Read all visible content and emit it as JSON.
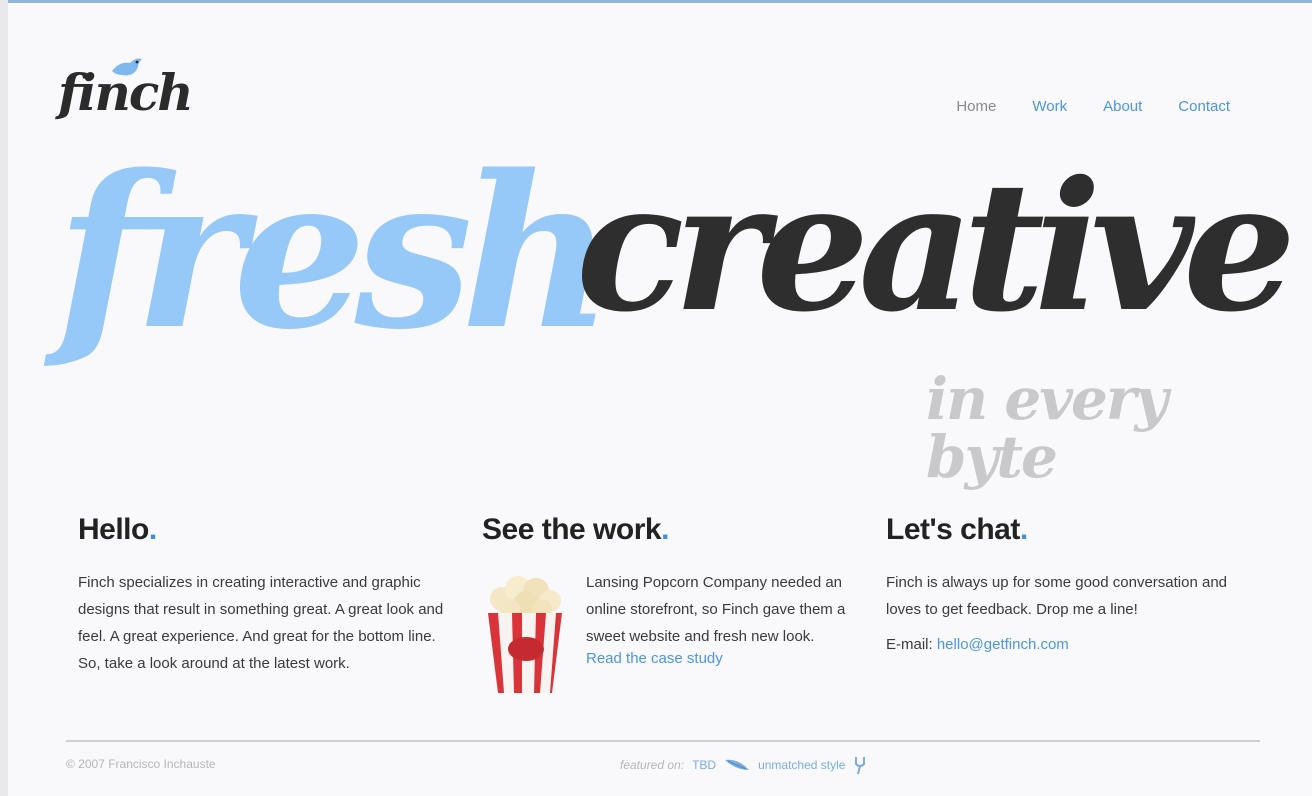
{
  "logo": {
    "text": "finch"
  },
  "nav": {
    "items": [
      {
        "label": "Home",
        "current": true
      },
      {
        "label": "Work",
        "current": false
      },
      {
        "label": "About",
        "current": false
      },
      {
        "label": "Contact",
        "current": false
      }
    ]
  },
  "hero": {
    "word1": "fresh",
    "word2": "creative",
    "subline": "in every byte"
  },
  "hello": {
    "heading": "Hello",
    "body": "Finch specializes in creating interactive and graphic designs that result in something great. A great look and feel. A great experience. And great for the bottom line. So, take a look around at the latest work."
  },
  "work": {
    "heading": "See the work",
    "body": "Lansing Popcorn Company needed an online storefront, so Finch gave them a sweet website and fresh new look.",
    "link": "Read the case study"
  },
  "chat": {
    "heading": "Let's chat",
    "body": "Finch is always up for some good conversation and loves to get feedback. Drop me a line!",
    "email_label": "E-mail:",
    "email": "hello@getfinch.com"
  },
  "footer": {
    "copyright": "© 2007 Francisco Inchauste",
    "featured_label": "featured on:",
    "featured_links": [
      "TBD",
      "unmatched style"
    ]
  },
  "colors": {
    "accent_blue": "#97c9f8",
    "link_blue": "#4a96e6",
    "dark": "#2e2e2e",
    "light_gray": "#c9c9cc"
  }
}
